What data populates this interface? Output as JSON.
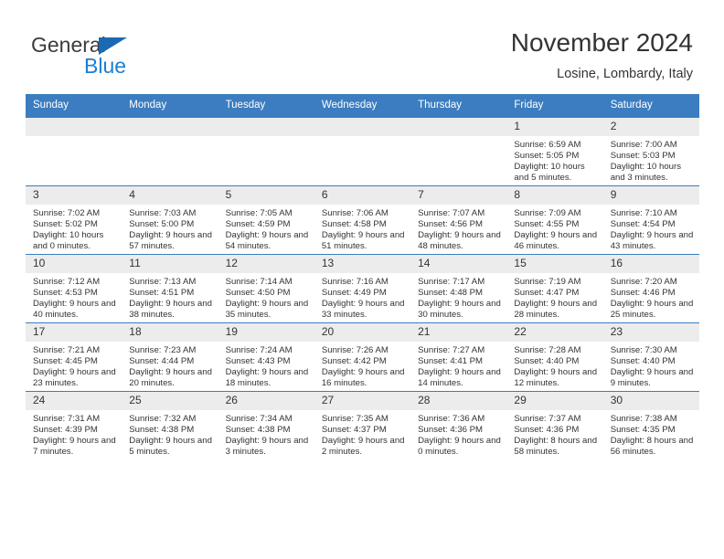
{
  "brand": {
    "name_part1": "General",
    "name_part2": "Blue",
    "triangle_color": "#1b69b3",
    "blue_color": "#1b7fd4"
  },
  "header": {
    "title": "November 2024",
    "location": "Losine, Lombardy, Italy"
  },
  "theme": {
    "header_blue": "#3b7dc0",
    "daynum_band": "#ececec",
    "text": "#333333"
  },
  "weekdays": [
    "Sunday",
    "Monday",
    "Tuesday",
    "Wednesday",
    "Thursday",
    "Friday",
    "Saturday"
  ],
  "weeks": [
    [
      {
        "day": "",
        "empty": true
      },
      {
        "day": "",
        "empty": true
      },
      {
        "day": "",
        "empty": true
      },
      {
        "day": "",
        "empty": true
      },
      {
        "day": "",
        "empty": true
      },
      {
        "day": "1",
        "sunrise": "Sunrise: 6:59 AM",
        "sunset": "Sunset: 5:05 PM",
        "daylight": "Daylight: 10 hours and 5 minutes."
      },
      {
        "day": "2",
        "sunrise": "Sunrise: 7:00 AM",
        "sunset": "Sunset: 5:03 PM",
        "daylight": "Daylight: 10 hours and 3 minutes."
      }
    ],
    [
      {
        "day": "3",
        "sunrise": "Sunrise: 7:02 AM",
        "sunset": "Sunset: 5:02 PM",
        "daylight": "Daylight: 10 hours and 0 minutes."
      },
      {
        "day": "4",
        "sunrise": "Sunrise: 7:03 AM",
        "sunset": "Sunset: 5:00 PM",
        "daylight": "Daylight: 9 hours and 57 minutes."
      },
      {
        "day": "5",
        "sunrise": "Sunrise: 7:05 AM",
        "sunset": "Sunset: 4:59 PM",
        "daylight": "Daylight: 9 hours and 54 minutes."
      },
      {
        "day": "6",
        "sunrise": "Sunrise: 7:06 AM",
        "sunset": "Sunset: 4:58 PM",
        "daylight": "Daylight: 9 hours and 51 minutes."
      },
      {
        "day": "7",
        "sunrise": "Sunrise: 7:07 AM",
        "sunset": "Sunset: 4:56 PM",
        "daylight": "Daylight: 9 hours and 48 minutes."
      },
      {
        "day": "8",
        "sunrise": "Sunrise: 7:09 AM",
        "sunset": "Sunset: 4:55 PM",
        "daylight": "Daylight: 9 hours and 46 minutes."
      },
      {
        "day": "9",
        "sunrise": "Sunrise: 7:10 AM",
        "sunset": "Sunset: 4:54 PM",
        "daylight": "Daylight: 9 hours and 43 minutes."
      }
    ],
    [
      {
        "day": "10",
        "sunrise": "Sunrise: 7:12 AM",
        "sunset": "Sunset: 4:53 PM",
        "daylight": "Daylight: 9 hours and 40 minutes."
      },
      {
        "day": "11",
        "sunrise": "Sunrise: 7:13 AM",
        "sunset": "Sunset: 4:51 PM",
        "daylight": "Daylight: 9 hours and 38 minutes."
      },
      {
        "day": "12",
        "sunrise": "Sunrise: 7:14 AM",
        "sunset": "Sunset: 4:50 PM",
        "daylight": "Daylight: 9 hours and 35 minutes."
      },
      {
        "day": "13",
        "sunrise": "Sunrise: 7:16 AM",
        "sunset": "Sunset: 4:49 PM",
        "daylight": "Daylight: 9 hours and 33 minutes."
      },
      {
        "day": "14",
        "sunrise": "Sunrise: 7:17 AM",
        "sunset": "Sunset: 4:48 PM",
        "daylight": "Daylight: 9 hours and 30 minutes."
      },
      {
        "day": "15",
        "sunrise": "Sunrise: 7:19 AM",
        "sunset": "Sunset: 4:47 PM",
        "daylight": "Daylight: 9 hours and 28 minutes."
      },
      {
        "day": "16",
        "sunrise": "Sunrise: 7:20 AM",
        "sunset": "Sunset: 4:46 PM",
        "daylight": "Daylight: 9 hours and 25 minutes."
      }
    ],
    [
      {
        "day": "17",
        "sunrise": "Sunrise: 7:21 AM",
        "sunset": "Sunset: 4:45 PM",
        "daylight": "Daylight: 9 hours and 23 minutes."
      },
      {
        "day": "18",
        "sunrise": "Sunrise: 7:23 AM",
        "sunset": "Sunset: 4:44 PM",
        "daylight": "Daylight: 9 hours and 20 minutes."
      },
      {
        "day": "19",
        "sunrise": "Sunrise: 7:24 AM",
        "sunset": "Sunset: 4:43 PM",
        "daylight": "Daylight: 9 hours and 18 minutes."
      },
      {
        "day": "20",
        "sunrise": "Sunrise: 7:26 AM",
        "sunset": "Sunset: 4:42 PM",
        "daylight": "Daylight: 9 hours and 16 minutes."
      },
      {
        "day": "21",
        "sunrise": "Sunrise: 7:27 AM",
        "sunset": "Sunset: 4:41 PM",
        "daylight": "Daylight: 9 hours and 14 minutes."
      },
      {
        "day": "22",
        "sunrise": "Sunrise: 7:28 AM",
        "sunset": "Sunset: 4:40 PM",
        "daylight": "Daylight: 9 hours and 12 minutes."
      },
      {
        "day": "23",
        "sunrise": "Sunrise: 7:30 AM",
        "sunset": "Sunset: 4:40 PM",
        "daylight": "Daylight: 9 hours and 9 minutes."
      }
    ],
    [
      {
        "day": "24",
        "sunrise": "Sunrise: 7:31 AM",
        "sunset": "Sunset: 4:39 PM",
        "daylight": "Daylight: 9 hours and 7 minutes."
      },
      {
        "day": "25",
        "sunrise": "Sunrise: 7:32 AM",
        "sunset": "Sunset: 4:38 PM",
        "daylight": "Daylight: 9 hours and 5 minutes."
      },
      {
        "day": "26",
        "sunrise": "Sunrise: 7:34 AM",
        "sunset": "Sunset: 4:38 PM",
        "daylight": "Daylight: 9 hours and 3 minutes."
      },
      {
        "day": "27",
        "sunrise": "Sunrise: 7:35 AM",
        "sunset": "Sunset: 4:37 PM",
        "daylight": "Daylight: 9 hours and 2 minutes."
      },
      {
        "day": "28",
        "sunrise": "Sunrise: 7:36 AM",
        "sunset": "Sunset: 4:36 PM",
        "daylight": "Daylight: 9 hours and 0 minutes."
      },
      {
        "day": "29",
        "sunrise": "Sunrise: 7:37 AM",
        "sunset": "Sunset: 4:36 PM",
        "daylight": "Daylight: 8 hours and 58 minutes."
      },
      {
        "day": "30",
        "sunrise": "Sunrise: 7:38 AM",
        "sunset": "Sunset: 4:35 PM",
        "daylight": "Daylight: 8 hours and 56 minutes."
      }
    ]
  ]
}
